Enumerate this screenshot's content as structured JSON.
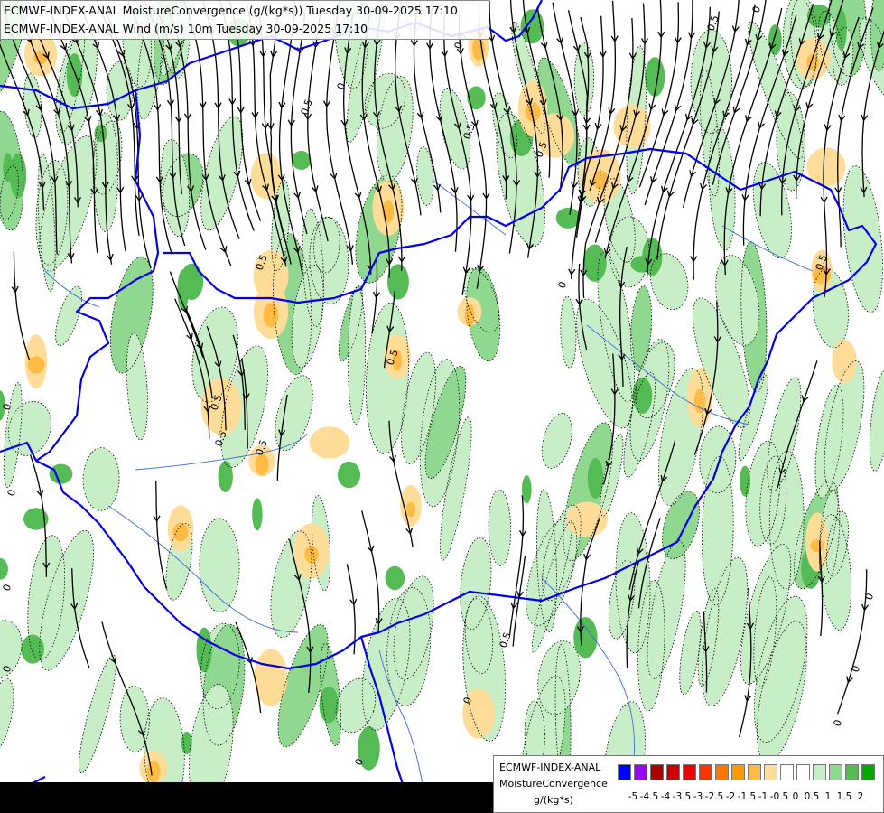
{
  "header": {
    "line1": "ECMWF-INDEX-ANAL MoistureConvergence (g/(kg*s)) Tuesday 30-09-2025 17:10",
    "line2": "ECMWF-INDEX-ANAL Wind (m/s) 10m Tuesday 30-09-2025 17:10"
  },
  "legend": {
    "model": "ECMWF-INDEX-ANAL",
    "field": "MoistureConvergence",
    "unit": "g/(kg*s)",
    "colors": [
      "#0000ff",
      "#9900ff",
      "#aa0000",
      "#cc0000",
      "#ee0000",
      "#ff3300",
      "#ff7700",
      "#ff9900",
      "#ffbb44",
      "#ffdd99",
      "#ffffff",
      "#ffffff",
      "#c8eec8",
      "#90d890",
      "#55bb55",
      "#00aa00"
    ],
    "ticks": [
      "-5",
      "-4.5",
      "-4",
      "-3.5",
      "-3",
      "-2.5",
      "-2",
      "-1.5",
      "-1",
      "-0.5",
      "0",
      "0.5",
      "1",
      "1.5",
      "2"
    ]
  },
  "contour_labels": [
    "0",
    "0",
    "0",
    "0",
    "0",
    "0",
    "0",
    "0",
    "0",
    "0",
    "0",
    "0",
    "0.5",
    "0.5",
    "0.5",
    "0.5",
    "0.5",
    "0.5",
    "0.5",
    "0.5",
    "0.5",
    "0.5",
    "0.5",
    "0.5"
  ],
  "colors": {
    "border": "#0000ee",
    "river": "#3b6fd6",
    "streamline": "#000000",
    "green_light": "#c8eec8",
    "green_mid": "#90d890",
    "green_dark": "#55bb55",
    "orange_light": "#ffdd99",
    "orange_mid": "#ffbb44"
  }
}
